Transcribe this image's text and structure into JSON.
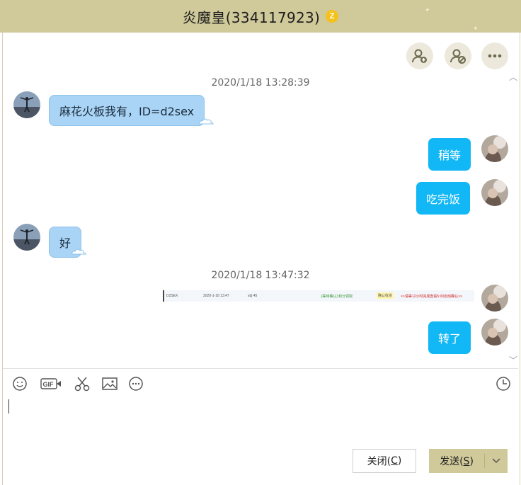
{
  "window": {
    "title": "炎魔皇(334117923)",
    "vip_badge": "Z"
  },
  "header_actions": [
    {
      "name": "add-friend-icon"
    },
    {
      "name": "create-group-icon"
    },
    {
      "name": "more-icon"
    }
  ],
  "messages": {
    "timestamp_1": "2020/1/18 13:28:39",
    "m1_text": "麻花火板我有，ID=d2sex",
    "m2_text": "稍等",
    "m3_text": "吃完饭",
    "m4_text": "好",
    "timestamp_2": "2020/1/18 13:47:32",
    "m5_image": {
      "c1": "D2SEX",
      "c2": "2020-1-18 13:47",
      "c3": "sdj 45",
      "c4": "[等待确认] 积分领取",
      "c5": "确认收货",
      "c6": "<<请等12小时完成查看5:00自动确认>>"
    },
    "m6_text": "转了"
  },
  "toolbar": [
    {
      "name": "emoji-icon"
    },
    {
      "name": "gif-icon",
      "label": "GIF"
    },
    {
      "name": "scissors-icon"
    },
    {
      "name": "image-icon"
    },
    {
      "name": "more-tools-icon"
    },
    {
      "name": "history-clock-icon"
    }
  ],
  "buttons": {
    "close_label": "关闭(",
    "close_key": "C",
    "close_suffix": ")",
    "send_label": "发送(",
    "send_key": "S",
    "send_suffix": ")"
  },
  "colors": {
    "titlebar": "#d0c99a",
    "bubble_received": "#a9d4f5",
    "bubble_sent": "#12b7f5"
  }
}
